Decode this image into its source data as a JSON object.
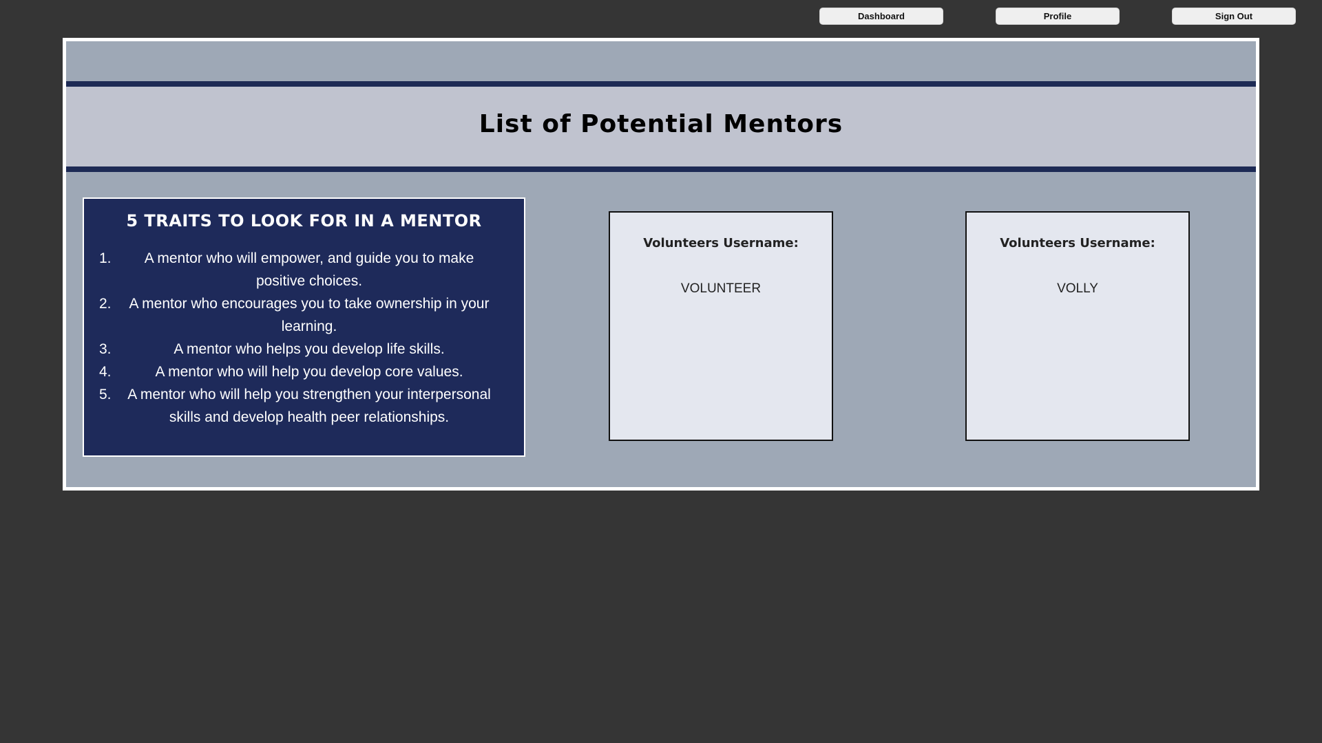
{
  "nav": {
    "dashboard_label": "Dashboard",
    "profile_label": "Profile",
    "signout_label": "Sign Out"
  },
  "page": {
    "title": "List of Potential Mentors"
  },
  "traits": {
    "title": "5 TRAITS TO LOOK FOR IN A MENTOR",
    "items": [
      {
        "num": "1.",
        "text": "A mentor who will empower, and guide you to make positive choices."
      },
      {
        "num": "2.",
        "text": "A mentor who encourages you to take ownership in your learning."
      },
      {
        "num": "3.",
        "text": "A mentor who helps you develop life skills."
      },
      {
        "num": "4.",
        "text": "A mentor who will help you develop core values."
      },
      {
        "num": "5.",
        "text": "A mentor who will help you strengthen your interpersonal skills and develop health peer relationships."
      }
    ]
  },
  "volunteers": [
    {
      "label": "Volunteers Username:",
      "username": "VOLUNTEER"
    },
    {
      "label": "Volunteers Username:",
      "username": "VOLLY"
    }
  ],
  "colors": {
    "page_background": "#353535",
    "frame_border": "#ffffff",
    "frame_background": "#9ea8b6",
    "title_band": "#c0c3cf",
    "accent_navy": "#1d2a55",
    "traits_background": "#1e2a5a",
    "card_background": "#e4e7ef",
    "nav_button": "#efefef"
  }
}
